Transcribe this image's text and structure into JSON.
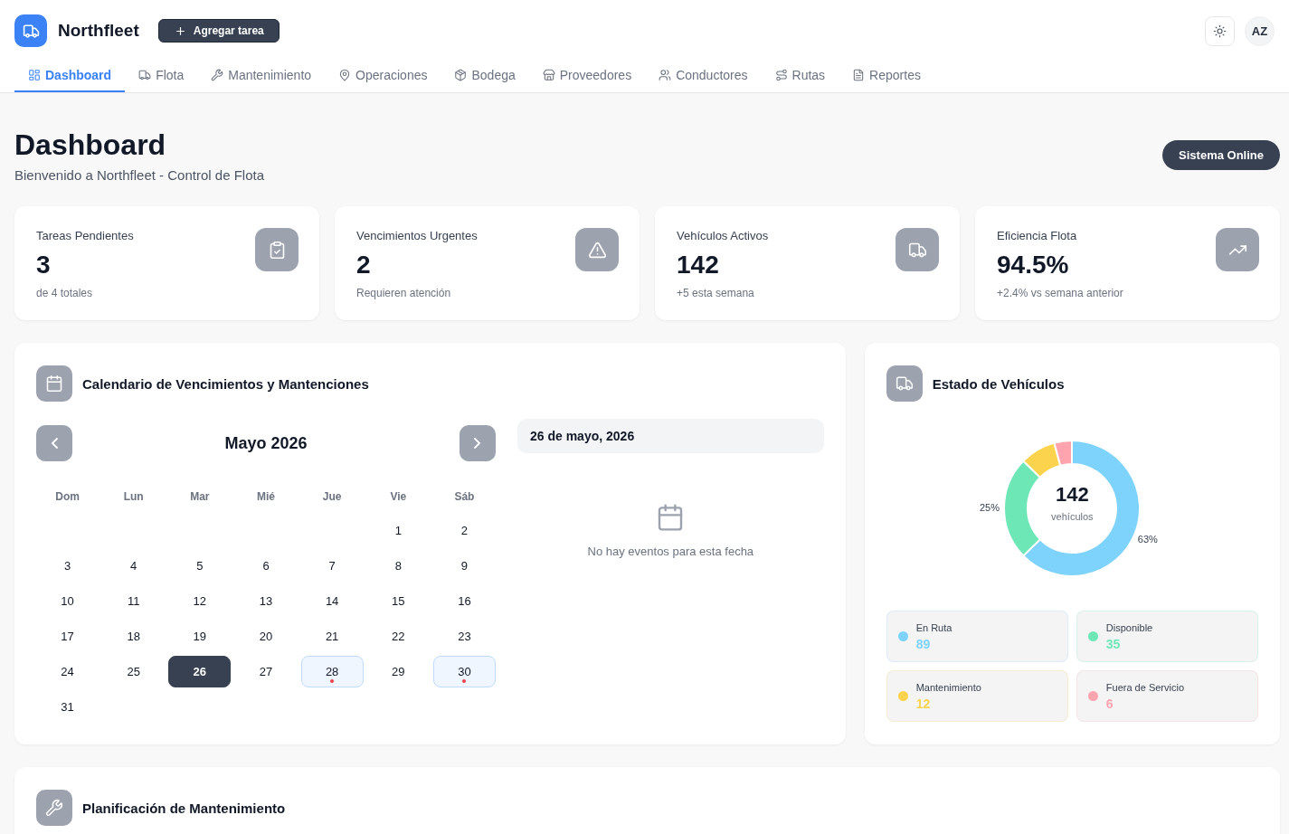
{
  "header": {
    "brand": "Northfleet",
    "add_button": "Agregar tarea",
    "avatar": "AZ"
  },
  "nav_tabs": [
    {
      "label": "Dashboard",
      "selected": true
    },
    {
      "label": "Flota",
      "selected": false
    },
    {
      "label": "Mantenimiento",
      "selected": false
    },
    {
      "label": "Operaciones",
      "selected": false
    },
    {
      "label": "Bodega",
      "selected": false
    },
    {
      "label": "Proveedores",
      "selected": false
    },
    {
      "label": "Conductores",
      "selected": false
    },
    {
      "label": "Rutas",
      "selected": false
    },
    {
      "label": "Reportes",
      "selected": false
    }
  ],
  "page": {
    "title": "Dashboard",
    "subtitle": "Bienvenido a Northfleet - Control de Flota",
    "status_badge": "Sistema Online"
  },
  "stats": [
    {
      "label": "Tareas Pendientes",
      "value": "3",
      "note": "de 4 totales"
    },
    {
      "label": "Vencimientos Urgentes",
      "value": "2",
      "note": "Requieren atención"
    },
    {
      "label": "Vehículos Activos",
      "value": "142",
      "note": "+5 esta semana"
    },
    {
      "label": "Eficiencia Flota",
      "value": "94.5%",
      "note": "+2.4% vs semana anterior"
    }
  ],
  "calendar": {
    "title": "Calendario de Vencimientos y Mantenciones",
    "month": "Mayo 2026",
    "weekdays": [
      "Dom",
      "Lun",
      "Mar",
      "Mié",
      "Jue",
      "Vie",
      "Sáb"
    ],
    "weeks": [
      [
        {
          "day": "1",
          "selected": false,
          "has_event": false
        },
        {
          "day": "2",
          "selected": false,
          "has_event": false
        }
      ],
      [
        {
          "day": "3",
          "selected": false,
          "has_event": false
        },
        {
          "day": "4",
          "selected": false,
          "has_event": false
        },
        {
          "day": "5",
          "selected": false,
          "has_event": false
        },
        {
          "day": "6",
          "selected": false,
          "has_event": false
        },
        {
          "day": "7",
          "selected": false,
          "has_event": false
        },
        {
          "day": "8",
          "selected": false,
          "has_event": false
        },
        {
          "day": "9",
          "selected": false,
          "has_event": false
        }
      ],
      [
        {
          "day": "10",
          "selected": false,
          "has_event": false
        },
        {
          "day": "11",
          "selected": false,
          "has_event": false
        },
        {
          "day": "12",
          "selected": false,
          "has_event": false
        },
        {
          "day": "13",
          "selected": false,
          "has_event": false
        },
        {
          "day": "14",
          "selected": false,
          "has_event": false
        },
        {
          "day": "15",
          "selected": false,
          "has_event": false
        },
        {
          "day": "16",
          "selected": false,
          "has_event": false
        }
      ],
      [
        {
          "day": "17",
          "selected": false,
          "has_event": false
        },
        {
          "day": "18",
          "selected": false,
          "has_event": false
        },
        {
          "day": "19",
          "selected": false,
          "has_event": false
        },
        {
          "day": "20",
          "selected": false,
          "has_event": false
        },
        {
          "day": "21",
          "selected": false,
          "has_event": false
        },
        {
          "day": "22",
          "selected": false,
          "has_event": false
        },
        {
          "day": "23",
          "selected": false,
          "has_event": false
        }
      ],
      [
        {
          "day": "24",
          "selected": false,
          "has_event": false
        },
        {
          "day": "25",
          "selected": false,
          "has_event": false
        },
        {
          "day": "26",
          "selected": true,
          "has_event": false
        },
        {
          "day": "27",
          "selected": false,
          "has_event": false
        },
        {
          "day": "28",
          "selected": false,
          "has_event": true
        },
        {
          "day": "29",
          "selected": false,
          "has_event": false
        },
        {
          "day": "30",
          "selected": false,
          "has_event": true
        }
      ],
      [
        {
          "day": "31",
          "selected": false,
          "has_event": false
        }
      ]
    ],
    "selected_date": "26 de mayo, 2026",
    "empty_message": "No hay eventos para esta fecha"
  },
  "vehicle_status": {
    "title": "Estado de Vehículos",
    "chart_data": {
      "type": "donut",
      "categories": [
        "En Ruta",
        "Disponible",
        "Mantenimiento",
        "Fuera de Servicio"
      ],
      "values": [
        62.7,
        24.6,
        8.5,
        4.2
      ],
      "value_labels": [
        "63%",
        "25%",
        null,
        null
      ]
    },
    "center_value": "142",
    "center_label": "vehículos",
    "legend": [
      {
        "value": "89",
        "color": "#7dd3fc"
      },
      {
        "value": "35",
        "color": "#6ee7b7"
      },
      {
        "value": "12",
        "color": "#fcd34d"
      },
      {
        "value": "6",
        "color": "#fda4af"
      }
    ]
  },
  "maintenance": {
    "title": "Planificación de Mantenimiento"
  }
}
